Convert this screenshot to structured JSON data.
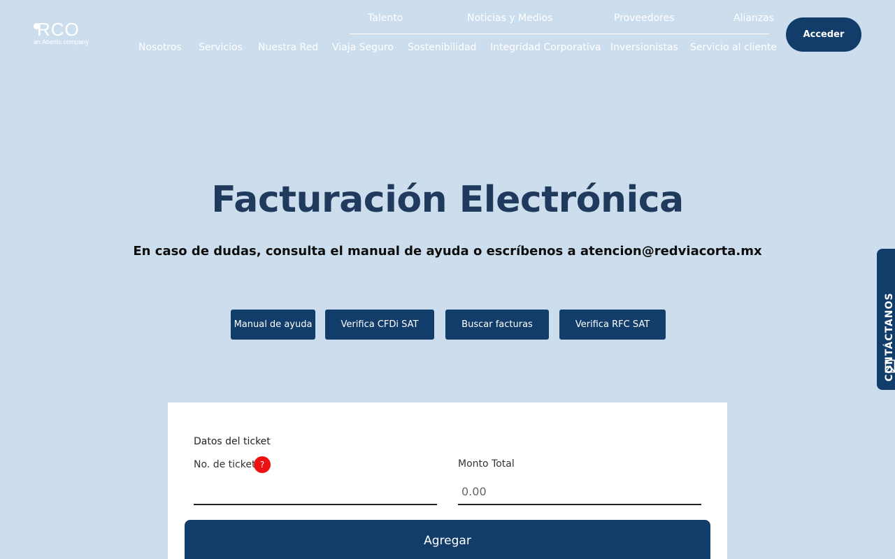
{
  "header": {
    "logo": {
      "text": "RCO",
      "subtext": "an Abertis company"
    },
    "top_nav": [
      "Talento",
      "Noticias y Medios",
      "Proveedores",
      "Alianzas"
    ],
    "main_nav": [
      "Nosotros",
      "Servicios",
      "Nuestra Red",
      "Viaja Seguro",
      "Sostenibilidad",
      "Integridad Corporativa",
      "Inversionistas",
      "Servicio al cliente"
    ],
    "login_label": "Acceder"
  },
  "hero": {
    "title": "Facturación Electrónica",
    "subtitle": "En caso de dudas, consulta el manual de ayuda o escríbenos a atencion@redviacorta.mx",
    "buttons": [
      "Manual de ayuda",
      "Verifica CFDi SAT",
      "Buscar facturas",
      "Verifica RFC SAT"
    ]
  },
  "side_tab": {
    "label": "CONTÁCTANOS",
    "icon": "mail-icon"
  },
  "form": {
    "section_title": "Datos del ticket",
    "ticket_label": "No. de ticket",
    "help_badge": "?",
    "ticket_value": "",
    "amount_label": "Monto Total",
    "amount_placeholder": "0.00",
    "submit_label": "Agregar"
  },
  "colors": {
    "page_background": "#ccddee",
    "primary_navy": "#123d6b",
    "title_text": "#1f3a5c",
    "help_badge_red": "#ee1111",
    "card_background": "#ffffff"
  }
}
